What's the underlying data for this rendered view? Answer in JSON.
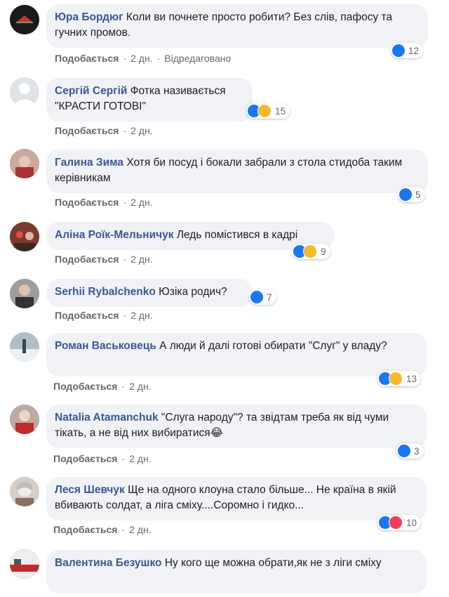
{
  "colors": {
    "author": "#385898",
    "bubble": "#f0f2f5",
    "like_blue": "#1877f2",
    "meta": "#65676b"
  },
  "comments": [
    {
      "author": "Юра Бордюг",
      "text": "Коли ви почнете просто робити? Без слів, пафосу та гучних промов.",
      "like_label": "Подобається",
      "time": "2 дн.",
      "edited": "Відредаговано",
      "reactions": [
        "like-icon"
      ],
      "count": "12"
    },
    {
      "author": "Сергій Сергій",
      "text": "Фотка називається \"КРАСТИ ГОТОВІ\"",
      "like_label": "Подобається",
      "time": "2 дн.",
      "reactions": [
        "like-icon",
        "haha-icon"
      ],
      "count": "15"
    },
    {
      "author": "Галина Зима",
      "text": "Хотя би посуд і бокали забрали з стола стидоба таким керівникам",
      "like_label": "Подобається",
      "time": "2 дн.",
      "reactions": [
        "like-icon"
      ],
      "count": "5"
    },
    {
      "author": "Аліна Роїк-Мельничук",
      "text": "Ледь помістився в кадрі",
      "like_label": "Подобається",
      "time": "2 дн.",
      "reactions": [
        "like-icon",
        "haha-icon"
      ],
      "count": "9"
    },
    {
      "author": "Serhii Rybalchenko",
      "text": "Юзіка родич?",
      "like_label": "Подобається",
      "time": "2 дн.",
      "reactions": [
        "like-icon"
      ],
      "count": "7"
    },
    {
      "author": "Роман Васьковець",
      "text": "А люди й далі готові обирати \"Слуг\" у владу?",
      "like_label": "Подобається",
      "time": "2 дн.",
      "reactions": [
        "like-icon",
        "sad-icon"
      ],
      "count": "13"
    },
    {
      "author": "Natalia Atamanchuk",
      "text": "\"Слуга народу\"? та звідтам треба як від чуми тікать, а не від них вибиратися😂",
      "like_label": "Подобається",
      "time": "2 дн.",
      "reactions": [
        "like-icon"
      ],
      "count": "3"
    },
    {
      "author": "Леся Шевчук",
      "text": "Ще на одного клоуна стало більше... Не країна в якій вбивають солдат, а ліга сміху....Соромно і гидко...",
      "like_label": "Подобається",
      "time": "2 дн.",
      "reactions": [
        "like-icon",
        "love-icon"
      ],
      "count": "10"
    },
    {
      "author": "Валентина Безушко",
      "text": "Ну кого ще можна обрати,як не з ліги сміху",
      "like_label": "",
      "time": "",
      "reactions": [],
      "count": ""
    }
  ]
}
